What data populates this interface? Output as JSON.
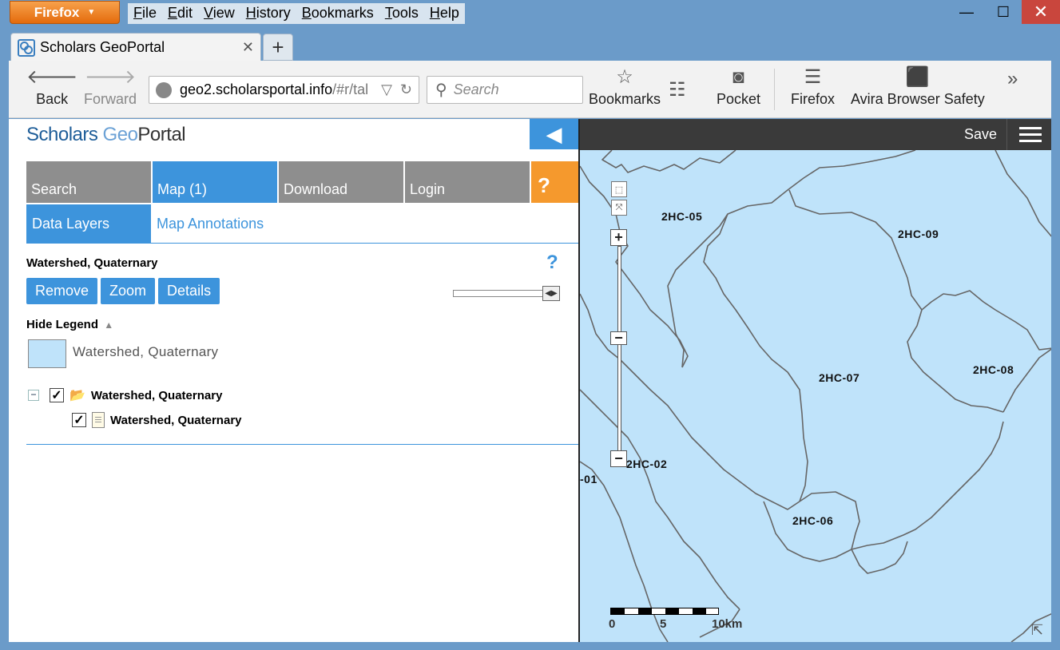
{
  "browser": {
    "app_button": "Firefox",
    "menu": [
      "File",
      "Edit",
      "View",
      "History",
      "Bookmarks",
      "Tools",
      "Help"
    ],
    "tab_title": "Scholars GeoPortal",
    "url_host": "geo2.scholarsportal.info",
    "url_rest": "/#r/tal",
    "search_placeholder": "Search",
    "toolbar": {
      "back": "Back",
      "forward": "Forward",
      "bookmarks": "Bookmarks",
      "pocket": "Pocket",
      "firefox": "Firefox",
      "avira": "Avira Browser Safety"
    }
  },
  "app": {
    "logo_scholars": "Scholars ",
    "logo_geo": "Geo",
    "logo_portal": "Portal",
    "tabs": [
      "Search",
      "Map (1)",
      "Download",
      "Login",
      "?"
    ],
    "subtabs": [
      "Data Layers",
      "Map Annotations"
    ],
    "layer_title": "Watershed, Quaternary",
    "help": "?",
    "actions": [
      "Remove",
      "Zoom",
      "Details"
    ],
    "hide_legend": "Hide Legend",
    "legend_label": "Watershed, Quaternary",
    "tree_parent": "Watershed, Quaternary",
    "tree_child": "Watershed, Quaternary"
  },
  "map": {
    "save": "Save",
    "labels": [
      "2HC-05",
      "2HC-09",
      "2HC-07",
      "2HC-08",
      "2HC-02",
      "-01",
      "2HC-06"
    ],
    "scale": [
      "0",
      "5",
      "10km"
    ],
    "fill_color": "#bfe3fa",
    "boundary_color": "#666666"
  }
}
